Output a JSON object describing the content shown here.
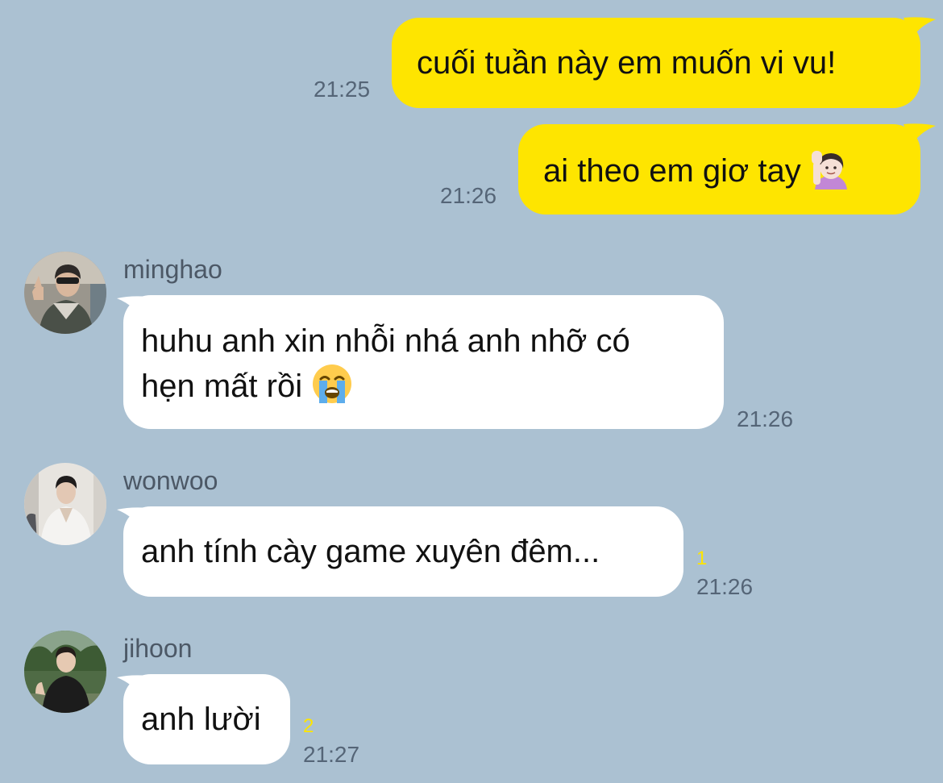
{
  "chat": {
    "messages": [
      {
        "direction": "outgoing",
        "text": "cuối tuần này em muốn vi vu!",
        "time": "21:25"
      },
      {
        "direction": "outgoing",
        "text": "ai theo em giơ tay",
        "emoji": "person-raising-hand-emoji",
        "time": "21:26"
      },
      {
        "direction": "incoming",
        "sender": "minghao",
        "line1": "huhu anh xin nhỗi nhá anh nhỡ có",
        "line2": "hẹn mất rồi",
        "emoji": "loudly-crying-face-emoji",
        "time": "21:26"
      },
      {
        "direction": "incoming",
        "sender": "wonwoo",
        "text": "anh tính cày game xuyên đêm...",
        "unread": "1",
        "time": "21:26"
      },
      {
        "direction": "incoming",
        "sender": "jihoon",
        "text": "anh lười",
        "unread": "2",
        "time": "21:27"
      }
    ]
  },
  "colors": {
    "background": "#abc1d2",
    "outgoing_bubble": "#fee500",
    "incoming_bubble": "#ffffff",
    "timestamp": "#556577",
    "unread_count": "#fee500"
  }
}
